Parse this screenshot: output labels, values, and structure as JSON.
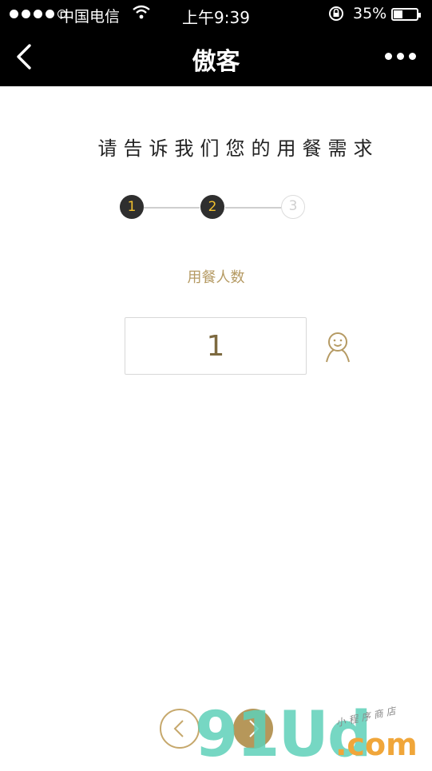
{
  "status_bar": {
    "carrier": "中国电信",
    "time": "上午9:39",
    "battery": "35%",
    "battery_level": 0.35
  },
  "nav": {
    "title": "傲客"
  },
  "form": {
    "prompt": "请告诉我们您的用餐需求",
    "steps": [
      "1",
      "2",
      "3"
    ],
    "current_step": 2,
    "field_label": "用餐人数",
    "guest_count": "1"
  },
  "watermark": {
    "brand": "91Ud",
    "domain": ".com",
    "tagline": "小程序商店"
  },
  "colors": {
    "accent": "#b59a63",
    "step_active_bg": "#2f2f2f",
    "step_active_text": "#f2c12e"
  }
}
